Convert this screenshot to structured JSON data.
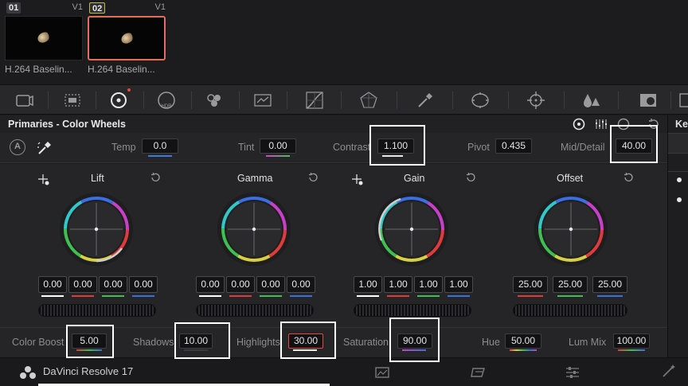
{
  "clips": [
    {
      "number": "01",
      "version": "V1",
      "name": "H.264 Baselin..."
    },
    {
      "number": "02",
      "version": "V1",
      "name": "H.264 Baselin..."
    }
  ],
  "toolbar": {
    "icons": [
      "camera-raw-icon",
      "color-match-icon",
      "color-wheels-icon",
      "hdr-icon",
      "rgb-mixer-icon",
      "motion-effects-icon",
      "curves-icon",
      "color-warper-icon",
      "qualifier-icon",
      "window-icon",
      "tracker-icon",
      "blur-icon",
      "key-icon",
      "sizing-icon"
    ],
    "hdr_label": "HDR"
  },
  "primaries": {
    "title": "Primaries - Color Wheels",
    "params_top": [
      {
        "label": "Temp",
        "value": "0.0",
        "bar_color": "#3c7ae0"
      },
      {
        "label": "Tint",
        "value": "0.00",
        "bar_color": "#4bbf5a"
      },
      {
        "label": "Contrast",
        "value": "1.100",
        "bar_color": "#e8e8e8"
      },
      {
        "label": "Pivot",
        "value": "0.435",
        "bar_color": "#888888"
      },
      {
        "label": "Mid/Detail",
        "value": "40.00",
        "bar_color": "#888888"
      }
    ],
    "wheels": [
      {
        "name": "Lift",
        "values": [
          "0.00",
          "0.00",
          "0.00",
          "0.00"
        ]
      },
      {
        "name": "Gamma",
        "values": [
          "0.00",
          "0.00",
          "0.00",
          "0.00"
        ]
      },
      {
        "name": "Gain",
        "values": [
          "1.00",
          "1.00",
          "1.00",
          "1.00"
        ]
      },
      {
        "name": "Offset",
        "values": [
          "25.00",
          "25.00",
          "25.00"
        ]
      }
    ],
    "params_bottom": [
      {
        "label": "Color Boost",
        "value": "5.00"
      },
      {
        "label": "Shadows",
        "value": "10.00"
      },
      {
        "label": "Highlights",
        "value": "30.00"
      },
      {
        "label": "Saturation",
        "value": "90.00"
      },
      {
        "label": "Hue",
        "value": "50.00"
      },
      {
        "label": "Lum Mix",
        "value": "100.00"
      }
    ]
  },
  "right_panel": {
    "title": "Key"
  },
  "status_bar": {
    "app_name": "DaVinci Resolve 17"
  },
  "colors": {
    "red": "#e03a3a",
    "green": "#3fbf50",
    "blue": "#3c6ee0",
    "white": "#ffffff",
    "selected_clip_border": "#e86a5c",
    "highlight_border": "#e14b3b"
  }
}
